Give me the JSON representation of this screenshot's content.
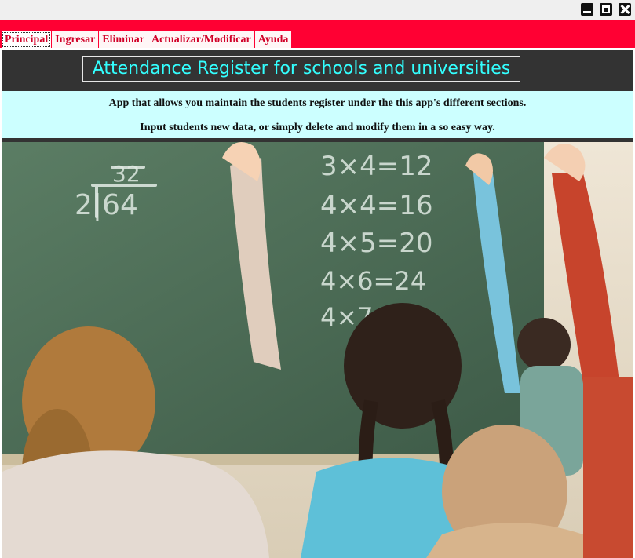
{
  "window": {
    "controls": [
      "minimize-icon",
      "maximize-icon",
      "close-icon"
    ]
  },
  "tabs": [
    {
      "label": "Principal",
      "active": true
    },
    {
      "label": "Ingresar",
      "active": false
    },
    {
      "label": "Eliminar",
      "active": false
    },
    {
      "label": "Actualizar/Modificar",
      "active": false
    },
    {
      "label": "Ayuda",
      "active": false
    }
  ],
  "main": {
    "title": "Attendance Register for schools and universities",
    "description_line1": "App that allows you maintain the students register under the this app's different sections.",
    "description_line2": "Input students new data, or simply delete and modify them in a so easy way."
  },
  "photo": {
    "subject": "classroom-photo",
    "board_text": [
      "32",
      "2|64",
      "3×4=12",
      "4×4=16",
      "4×5=20",
      "4×6=24",
      "4×7"
    ]
  },
  "colors": {
    "tab_band": "#ff0033",
    "tab_text": "#d10028",
    "header_bg": "#333333",
    "title_text": "#33ffff",
    "info_bg": "#ccffff"
  }
}
